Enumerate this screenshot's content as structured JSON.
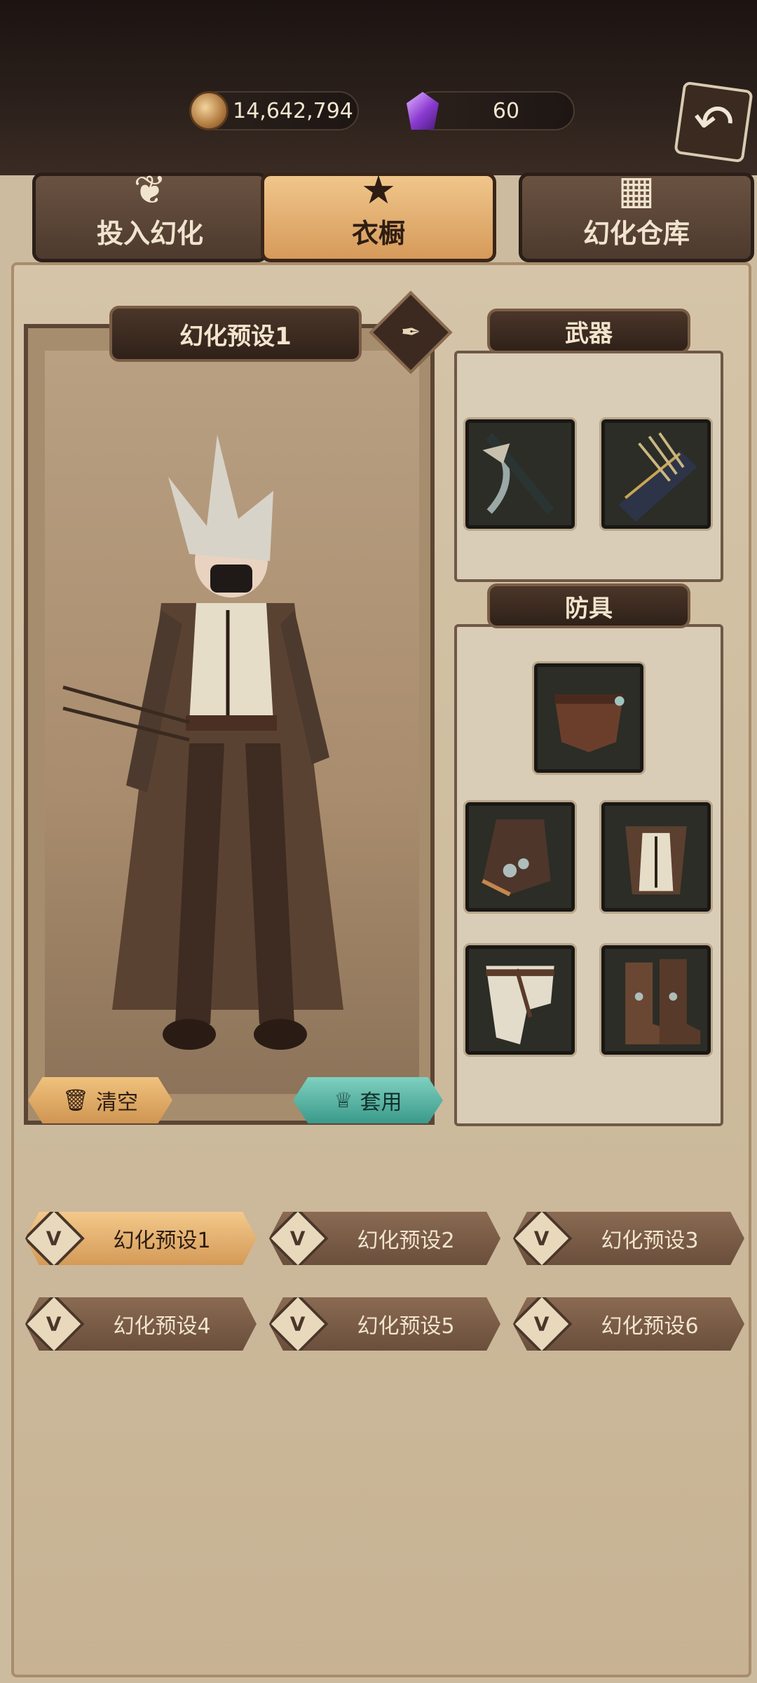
{
  "currency": {
    "gold": "14,642,794",
    "gems": "60"
  },
  "tabs": [
    {
      "label": "投入幻化",
      "icon": "mask-icon",
      "active": false
    },
    {
      "label": "衣橱",
      "icon": "wardrobe-crest-icon",
      "active": true
    },
    {
      "label": "幻化仓库",
      "icon": "cabinet-icon",
      "active": false
    }
  ],
  "preview": {
    "title": "幻化预设1",
    "clear_label": "清空",
    "apply_label": "套用"
  },
  "weapons": {
    "title": "武器"
  },
  "armor": {
    "title": "防具"
  },
  "presets": [
    {
      "label": "幻化预设1",
      "active": true
    },
    {
      "label": "幻化预设2",
      "active": false
    },
    {
      "label": "幻化预设3",
      "active": false
    },
    {
      "label": "幻化预设4",
      "active": false
    },
    {
      "label": "幻化预设5",
      "active": false
    },
    {
      "label": "幻化预设6",
      "active": false
    }
  ]
}
